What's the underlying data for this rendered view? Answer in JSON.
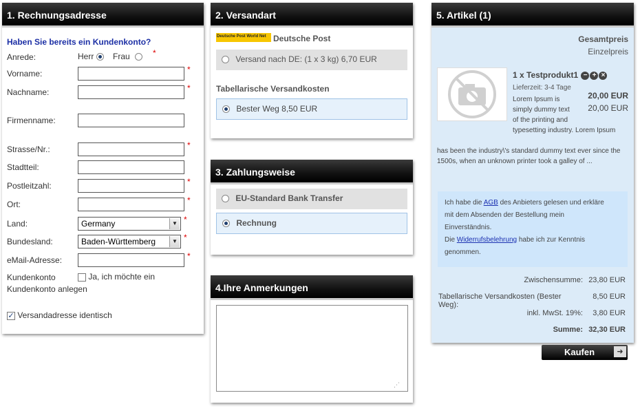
{
  "billing": {
    "title": "1. Rechnungsadresse",
    "account_link": "Haben Sie bereits ein Kundenkonto?",
    "salutation_label": "Anrede:",
    "salutation_options": [
      "Herr",
      "Frau"
    ],
    "salutation_selected": "Herr",
    "fields": {
      "vorname": "Vorname:",
      "nachname": "Nachname:",
      "firmenname": "Firmenname:",
      "strasse": "Strasse/Nr.:",
      "stadtteil": "Stadtteil:",
      "plz": "Postleitzahl:",
      "ort": "Ort:",
      "land": "Land:",
      "bundesland": "Bundesland:",
      "email": "eMail-Adresse:",
      "kundenkonto": "Kundenkonto"
    },
    "land_value": "Germany",
    "bundesland_value": "Baden-Württemberg",
    "create_account_text_1": "Ja, ich möchte ein",
    "create_account_text_2": "Kundenkonto anlegen",
    "same_shipping": "Versandadresse identisch",
    "required_mark": "*"
  },
  "shipping": {
    "title": "2. Versandart",
    "carrier_logo": "Deutsche Post  World Net",
    "carrier_name": "Deutsche Post",
    "option1": "Versand nach DE: (1 x 3 kg) 6,70 EUR",
    "table_heading": "Tabellarische Versandkosten",
    "option2": "Bester Weg 8,50 EUR"
  },
  "payment": {
    "title": "3. Zahlungsweise",
    "option1": "EU-Standard Bank Transfer",
    "option2": "Rechnung"
  },
  "notes": {
    "title": "4.Ihre Anmerkungen"
  },
  "cart": {
    "title": "5. Artikel (1)",
    "col_total": "Gesamtpreis",
    "col_unit": "Einzelpreis",
    "item_qty_name": "1 x Testprodukt1",
    "delivery": "Lieferzeit: 3-4 Tage",
    "desc_short": [
      "Lorem Ipsum is",
      "simply dummy text",
      "of the printing and",
      "typesetting industry. Lorem Ipsum"
    ],
    "desc_long": [
      "has been the industry\\'s standard dummy text ever since the",
      "1500s, when an unknown printer took a galley of ..."
    ],
    "price_total": "20,00 EUR",
    "price_unit": "20,00 EUR",
    "agb_pre": "Ich habe die ",
    "agb_link": "AGB",
    "agb_post1": " des Anbieters gelesen und erkläre",
    "agb_line2": "mit dem Absenden der Bestellung mein",
    "agb_line3": "Einverständnis.",
    "agb_die": "Die ",
    "widerruf_link": "Widerrufsbelehrung",
    "widerruf_post": " habe ich zur Kenntnis",
    "agb_line6": "genommen.",
    "subtotal_label": "Zwischensumme:",
    "subtotal_value": "23,80 EUR",
    "shipping_label": "Tabellarische Versandkosten (Bester Weg):",
    "shipping_value": "8,50 EUR",
    "tax_label": "inkl. MwSt. 19%:",
    "tax_value": "3,80 EUR",
    "sum_label": "Summe:",
    "sum_value": "32,30 EUR",
    "buy_label": "Kaufen"
  },
  "colors": {
    "header_bg": "#000000",
    "cart_bg": "#dcebf8",
    "link_blue": "#1c2fa5",
    "required": "#dd0000"
  }
}
